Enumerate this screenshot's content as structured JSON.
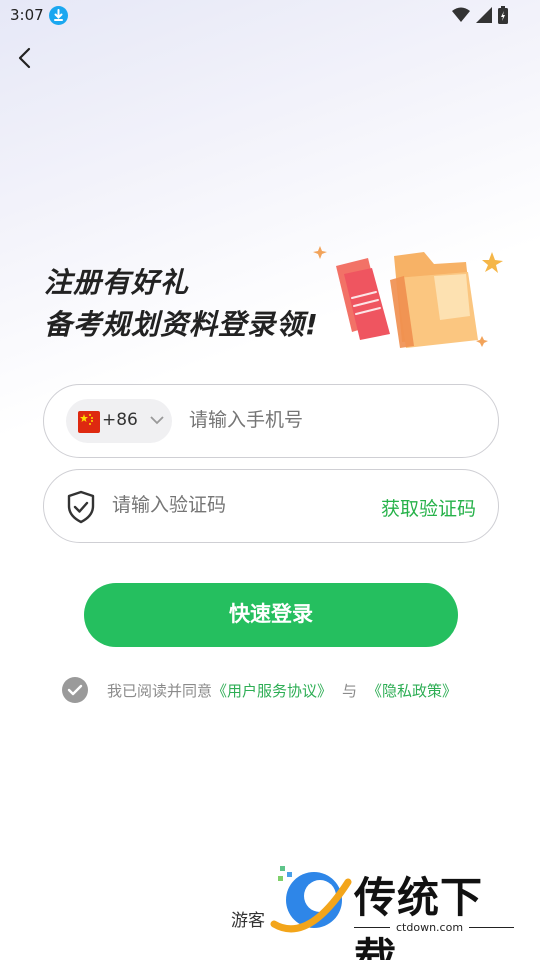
{
  "status": {
    "time": "3:07"
  },
  "headline": {
    "line1": "注册有好礼",
    "line2": "备考规划资料登录领!"
  },
  "phone": {
    "country_code": "+86",
    "placeholder": "请输入手机号"
  },
  "code": {
    "placeholder": "请输入验证码",
    "get_code_label": "获取验证码"
  },
  "login_button": "快速登录",
  "agreement": {
    "prefix": "我已阅读并同意",
    "terms": "《用户服务协议》",
    "and": "与",
    "privacy": "《隐私政策》"
  },
  "guest_label": "游客",
  "watermark": {
    "title": "传统下载",
    "url": "ctdown.com"
  },
  "colors": {
    "accent_green": "#25bf5f",
    "link_green": "#2eae55",
    "flag_red": "#de2910"
  },
  "icons": [
    "download-icon",
    "wifi-icon",
    "signal-icon",
    "battery-icon",
    "back-icon",
    "flag-icon",
    "chevron-down-icon",
    "shield-icon",
    "check-icon"
  ]
}
